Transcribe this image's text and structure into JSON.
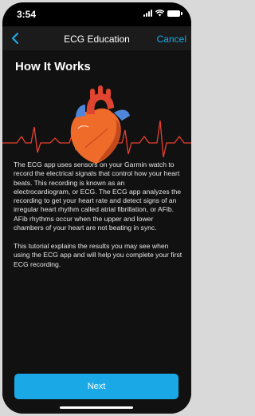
{
  "status": {
    "time": "3:54"
  },
  "nav": {
    "title": "ECG Education",
    "cancel_label": "Cancel"
  },
  "page": {
    "title": "How It Works",
    "paragraph1": "The ECG app uses sensors on your Garmin watch to record the electrical signals that control how your heart beats. This recording is known as an electrocardiogram, or ECG. The ECG app analyzes the recording to get your heart rate and detect signs of an irregular heart rhythm called atrial fibrillation, or AFib. AFib rhythms occur when the upper and lower chambers of your heart are not beating in sync.",
    "paragraph2": "This tutorial explains the results you may see when using the ECG app and will help you complete your first ECG recording."
  },
  "footer": {
    "next_label": "Next"
  },
  "colors": {
    "accent": "#1aa8e6",
    "ecg_line": "#e8402f",
    "heart": "#ef6b2a"
  },
  "icons": [
    "back-chevron-icon",
    "signal-icon",
    "wifi-icon",
    "battery-icon",
    "heart-illustration-icon"
  ]
}
